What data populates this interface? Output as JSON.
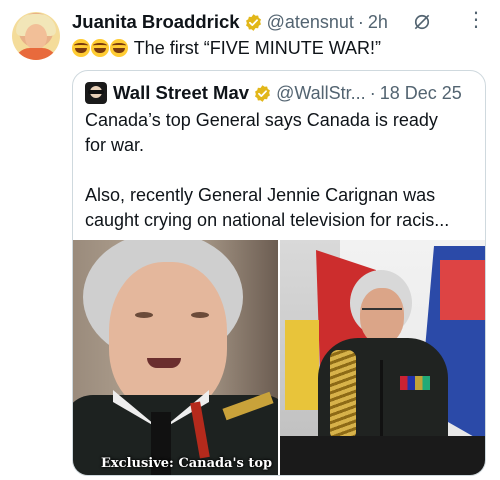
{
  "tweet": {
    "author_name": "Juanita Broaddrick",
    "handle": "@atensnut",
    "separator": "·",
    "time": "2h",
    "emojis": [
      "rofl",
      "rofl",
      "rofl"
    ],
    "text": "The first  “FIVE MINUTE WAR!”",
    "more_label": "⋮"
  },
  "quoted_tweet": {
    "author_name": "Wall Street Mav",
    "handle": "@WallStr...",
    "separator": "·",
    "date": "18 Dec 25",
    "text_lines": [
      "Canada’s top General says Canada is ready",
      "for war.",
      "",
      "Also, recently General Jennie Carignan was",
      "caught crying on national television for racis..."
    ],
    "media_caption": "Exclusive: Canada's top"
  },
  "colors": {
    "text_primary": "#0f1419",
    "text_secondary": "#536471",
    "verified_gold": "#e2b719",
    "border": "#cfd9de"
  },
  "icons": {
    "verified": "verified-badge-icon",
    "mute": "mute-icon",
    "more": "more-vertical-icon"
  }
}
